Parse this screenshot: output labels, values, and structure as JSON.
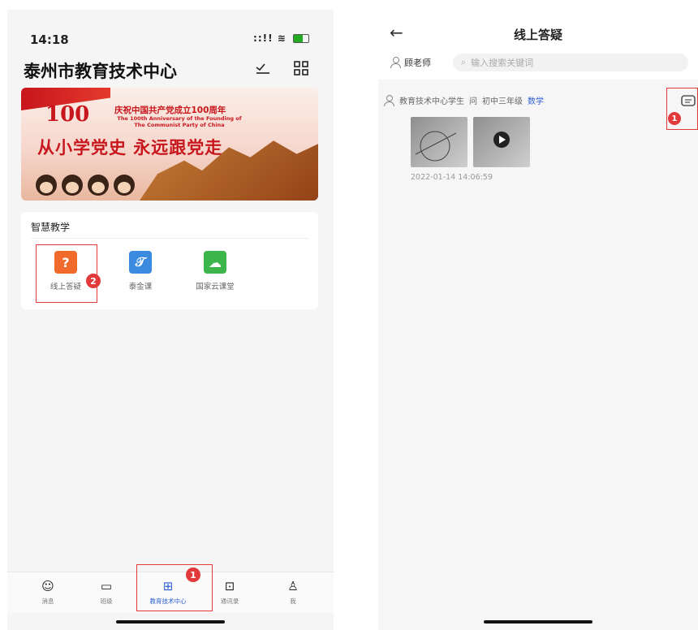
{
  "left": {
    "status": {
      "time": "14:18"
    },
    "header": {
      "title": "泰州市教育技术中心"
    },
    "banner": {
      "number": "100",
      "title_cn": "庆祝中国共产党成立100周年",
      "title_en_line1": "The 100th Anniversary of the Founding of",
      "title_en_line2": "The Communist Party of China",
      "slogan": "从小学党史 永远跟党走"
    },
    "section": {
      "title": "智慧教学",
      "tiles": [
        {
          "label": "线上答疑",
          "icon": "question-icon",
          "color": "#f06a2b"
        },
        {
          "label": "泰金课",
          "icon": "calligraphy-icon",
          "color": "#3a8be0"
        },
        {
          "label": "国家云课堂",
          "icon": "cloud-classroom-icon",
          "color": "#3cb64a"
        }
      ]
    },
    "tabs": [
      {
        "label": "消息",
        "icon": "message-icon"
      },
      {
        "label": "班级",
        "icon": "class-icon"
      },
      {
        "label": "教育技术中心",
        "icon": "grid-icon"
      },
      {
        "label": "通讯录",
        "icon": "contacts-icon"
      },
      {
        "label": "我",
        "icon": "profile-icon"
      }
    ],
    "markers": {
      "tab": "1",
      "tile": "2"
    }
  },
  "right": {
    "header": {
      "title": "线上答疑"
    },
    "user": "顾老师",
    "search": {
      "placeholder": "输入搜索关键词"
    },
    "post": {
      "author": "教育技术中心学生",
      "action": "问",
      "grade": "初中三年级",
      "subject": "数学",
      "time": "2022-01-14 14:06:59"
    },
    "markers": {
      "comment": "1"
    }
  },
  "colors": {
    "accent": "#2c5fd8",
    "highlight": "#e23a3a"
  }
}
